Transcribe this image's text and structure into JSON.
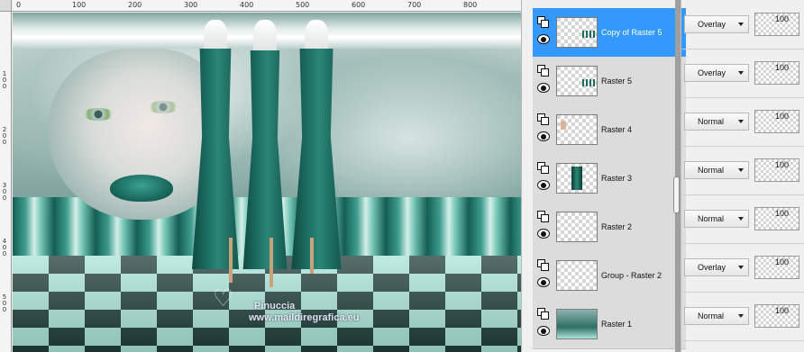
{
  "ruler": {
    "top_labels": [
      "0",
      "100",
      "200",
      "300",
      "400",
      "500",
      "600",
      "700",
      "800"
    ],
    "left_labels": [
      "100",
      "200",
      "300",
      "400",
      "500"
    ]
  },
  "canvas": {
    "watermark_name": "Pinuccia",
    "watermark_url": "www.maildiregrafica.eu",
    "palette": {
      "dress": "#1d6e62",
      "floor_dark": "#1f3d38",
      "floor_light": "#a9e3d6"
    }
  },
  "layers": [
    {
      "name": "Copy of Raster 5",
      "selected": true,
      "blend_mode": "Overlay",
      "opacity": "100",
      "thumb": "stripes"
    },
    {
      "name": "Raster 5",
      "selected": false,
      "blend_mode": "Overlay",
      "opacity": "100",
      "thumb": "stripes"
    },
    {
      "name": "Raster 4",
      "selected": false,
      "blend_mode": "Normal",
      "opacity": "100",
      "thumb": "figure"
    },
    {
      "name": "Raster 3",
      "selected": false,
      "blend_mode": "Normal",
      "opacity": "100",
      "thumb": "dresses"
    },
    {
      "name": "Raster 2",
      "selected": false,
      "blend_mode": "Normal",
      "opacity": "100",
      "thumb": "empty"
    },
    {
      "name": "Group - Raster 2",
      "selected": false,
      "blend_mode": "Overlay",
      "opacity": "100",
      "thumb": "empty"
    },
    {
      "name": "Raster 1",
      "selected": false,
      "blend_mode": "Normal",
      "opacity": "100",
      "thumb": "image"
    }
  ],
  "colors": {
    "selected_row": "#3399ff",
    "row_bg": "#dcdcdc",
    "scrollbar": "#9f9f9f"
  },
  "icons": {
    "visibility": "eye-icon",
    "layer_type": "raster-layer-icon",
    "dropdown": "chevron-down-icon"
  }
}
